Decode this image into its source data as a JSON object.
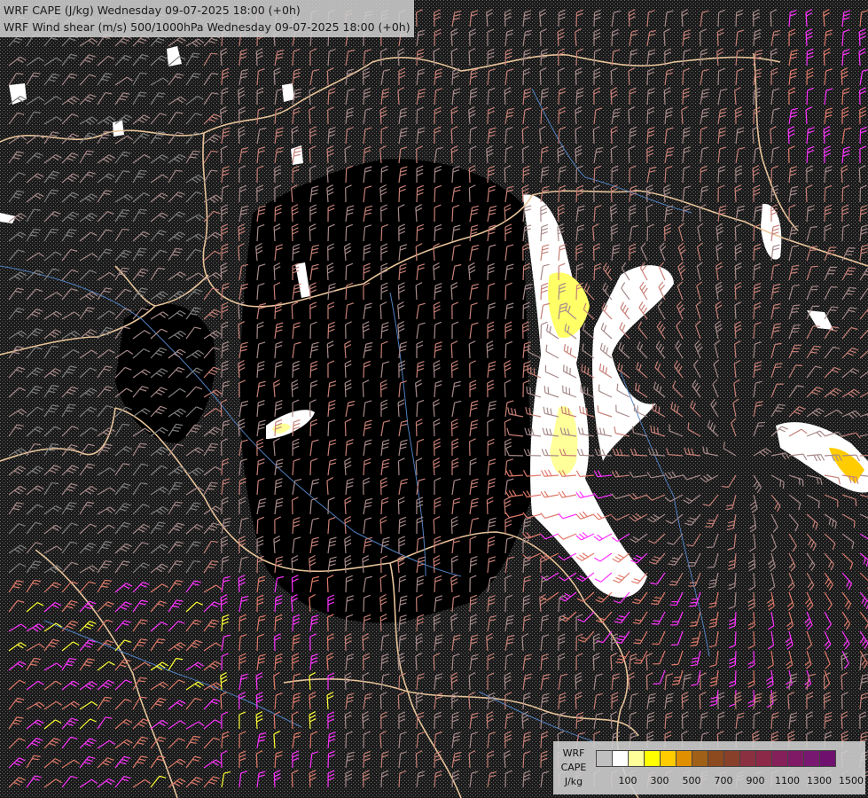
{
  "header": {
    "line1": "WRF CAPE (J/kg) Wednesday 09-07-2025 18:00 (+0h)",
    "line2": "WRF Wind shear (m/s) 500/1000hPa Wednesday 09-07-2025 18:00 (+0h)"
  },
  "legend": {
    "label_lines": [
      "WRF",
      "CAPE",
      "J/kg"
    ],
    "colors": [
      "#c0c0c0",
      "#ffffff",
      "#ffff99",
      "#ffff00",
      "#ffcc00",
      "#e08f00",
      "#a06018",
      "#8c4a1e",
      "#88402a",
      "#8a3040",
      "#8c2848",
      "#86205a",
      "#801a66",
      "#781870",
      "#70106e"
    ],
    "ticks": [
      "100",
      "300",
      "500",
      "700",
      "900",
      "1100",
      "1300",
      "1500"
    ]
  },
  "map_style": {
    "background": "#000000",
    "border_color": "#e8c49a",
    "river_color": "#4f7fbf",
    "barb_colors": [
      "#7f7f7f",
      "#a88a8a",
      "#c78077",
      "#e07a6a",
      "#ff33ff",
      "#ffff33"
    ],
    "cape_colors": [
      "#ffffff",
      "#ffff99",
      "#ffff00",
      "#e0a020"
    ]
  }
}
